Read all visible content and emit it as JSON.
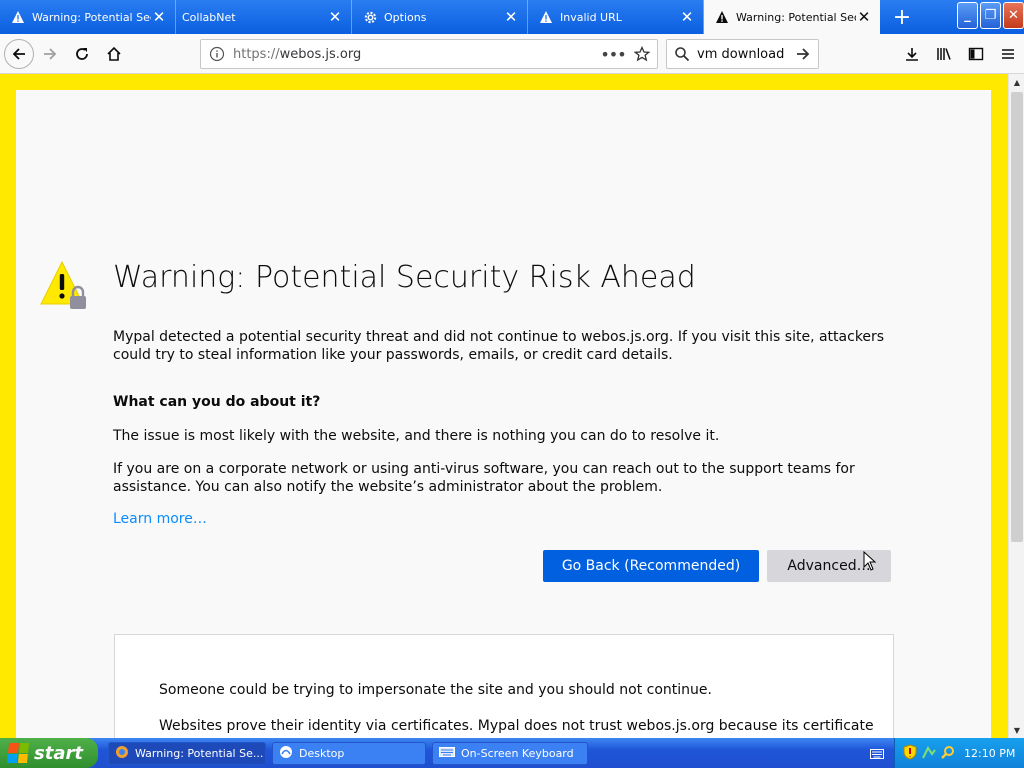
{
  "browser": {
    "tabs": [
      {
        "label": "Warning: Potential Secu",
        "icon": "warning-icon",
        "active": false
      },
      {
        "label": "CollabNet",
        "icon": "",
        "active": false
      },
      {
        "label": "Options",
        "icon": "gear-icon",
        "active": false
      },
      {
        "label": "Invalid URL",
        "icon": "warning-icon",
        "active": false
      },
      {
        "label": "Warning: Potential Secu",
        "icon": "warning-icon",
        "active": true
      }
    ],
    "new_tab": "+",
    "url_scheme": "https://",
    "url_host": "webos.js.org",
    "search_value": "vm download"
  },
  "page": {
    "title": "Warning: Potential Security Risk Ahead",
    "intro": "Mypal detected a potential security threat and did not continue to webos.js.org. If you visit this site, attackers could try to steal information like your passwords, emails, or credit card details.",
    "question": "What can you do about it?",
    "answer1": "The issue is most likely with the website, and there is nothing you can do to resolve it.",
    "answer2": "If you are on a corporate network or using anti-virus software, you can reach out to the support teams for assistance. You can also notify the website’s administrator about the problem.",
    "learn_more": "Learn more…",
    "go_back": "Go Back (Recommended)",
    "advanced": "Advanced…",
    "detail1": "Someone could be trying to impersonate the site and you should not continue.",
    "detail2": "Websites prove their identity via certificates. Mypal does not trust webos.js.org because its certificate"
  },
  "taskbar": {
    "start": "start",
    "items": [
      {
        "label": "Warning: Potential Se...",
        "active": true
      },
      {
        "label": "Desktop",
        "active": false
      },
      {
        "label": "On-Screen Keyboard",
        "active": false
      }
    ],
    "clock": "12:10 PM"
  },
  "colors": {
    "accent": "#0060df",
    "warning_border": "#ffe900",
    "link": "#0a8dff"
  }
}
